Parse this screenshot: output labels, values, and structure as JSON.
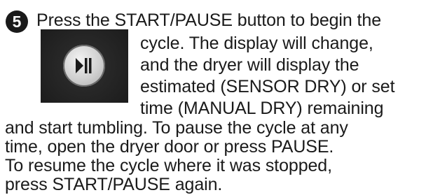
{
  "step": {
    "number": "5"
  },
  "icon": {
    "name": "play-pause-icon"
  },
  "text": {
    "line1": "Press the START/PAUSE button to begin the",
    "line2": "cycle. The display will change,",
    "line3": "and the dryer will display the",
    "line4": "estimated (SENSOR DRY) or set",
    "line5": "time (MANUAL DRY) remaining",
    "line6": "and start tumbling. To pause the cycle at any",
    "line7": "time, open the dryer door or press PAUSE.",
    "line8": "To resume the cycle where it was stopped,",
    "line9": "press START/PAUSE again."
  }
}
